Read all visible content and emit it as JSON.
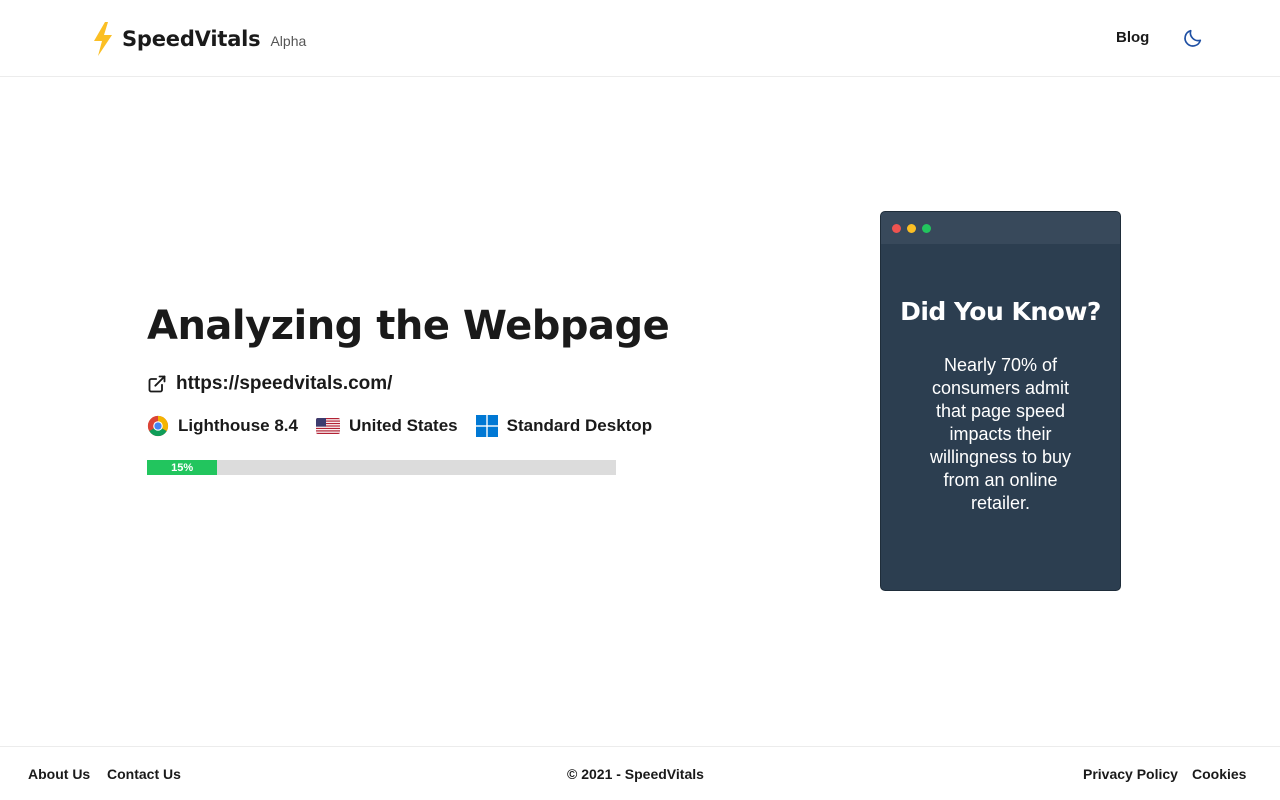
{
  "header": {
    "brand_name": "SpeedVitals",
    "brand_tag": "Alpha",
    "nav_blog": "Blog",
    "theme_icon": "moon-icon"
  },
  "main": {
    "title": "Analyzing the Webpage",
    "url": "https://speedvitals.com/",
    "meta": [
      {
        "icon": "chrome-icon",
        "label": "Lighthouse 8.4"
      },
      {
        "icon": "us-flag-icon",
        "label": "United States"
      },
      {
        "icon": "windows-icon",
        "label": "Standard Desktop"
      }
    ],
    "progress": {
      "value": 0.15,
      "label": "15%",
      "color": "#22c55e"
    }
  },
  "card": {
    "title": "Did You Know?",
    "body": "Nearly 70% of consumers admit that page speed impacts their willingness to buy from an online retailer.",
    "background": "#2c3e50",
    "dots": [
      "#ef5350",
      "#fbbf24",
      "#22c55e"
    ]
  },
  "footer": {
    "about": "About Us",
    "contact": "Contact Us",
    "copyright": "© 2021 - SpeedVitals",
    "privacy": "Privacy Policy",
    "cookies": "Cookies"
  }
}
